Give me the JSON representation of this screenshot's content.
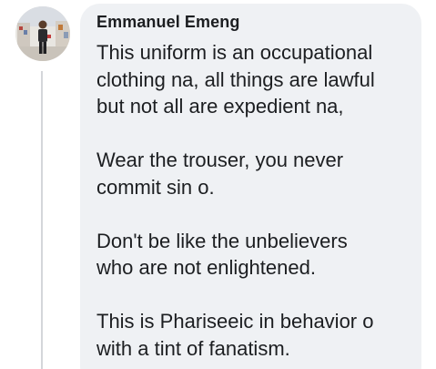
{
  "comment": {
    "author": "Emmanuel Emeng",
    "paragraphs": [
      "This uniform is an occupational\nclothing na, all things are lawful\nbut not all are expedient na,",
      "Wear the trouser, you never\ncommit sin o.",
      "Don't be like the unbelievers\nwho are not enlightened.",
      "This is Phariseeic in behavior o\nwith a tint of fanatism."
    ]
  },
  "colors": {
    "bubble": "#eff1f4",
    "text": "#1c1e21",
    "thread_line": "#d4d6da"
  }
}
